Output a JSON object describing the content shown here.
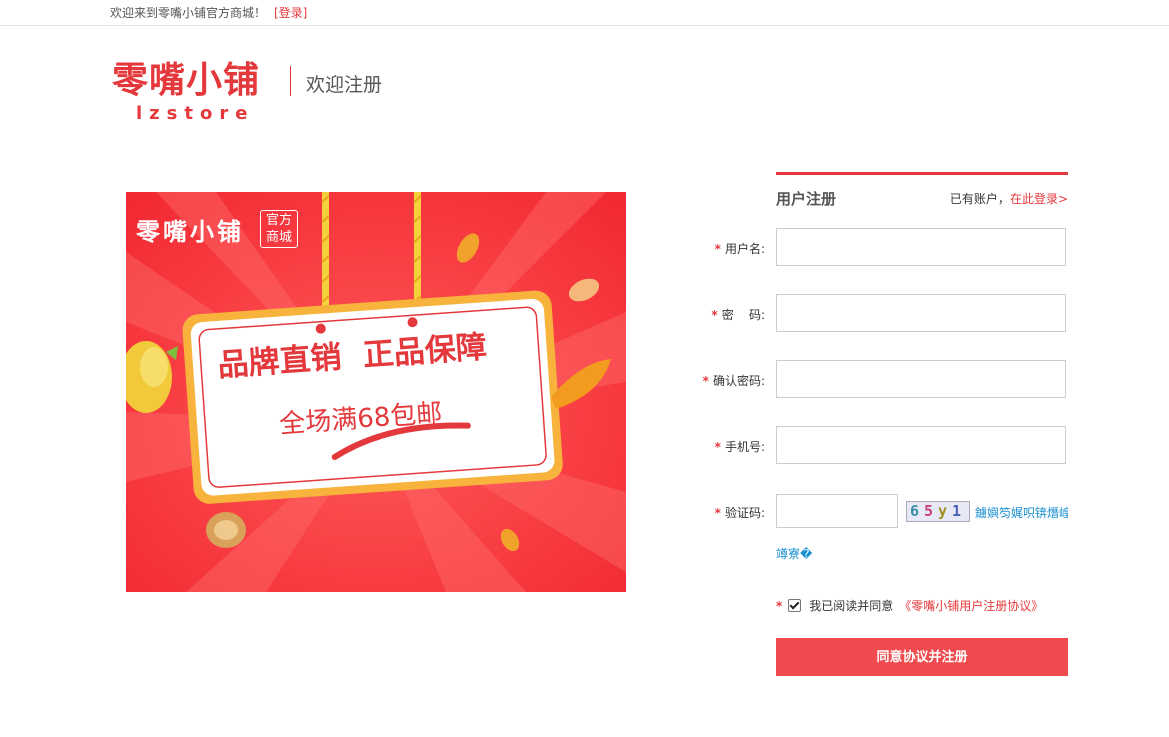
{
  "topbar": {
    "welcome": "欢迎来到零嘴小铺官方商城！",
    "login_link": "[登录]"
  },
  "header": {
    "logo_cn": "零嘴小铺",
    "logo_en": "lzstore",
    "page_title": "欢迎注册"
  },
  "banner": {
    "brand": "零嘴小铺",
    "badge_line1": "官方",
    "badge_line2": "商城",
    "headline": "品牌直销  正品保障",
    "subline": "全场满68包邮"
  },
  "form": {
    "title": "用户注册",
    "has_account": "已有账户，",
    "login_here": "在此登录>",
    "fields": {
      "username": {
        "label": "用户名:",
        "value": ""
      },
      "password": {
        "label": "密    码:",
        "value": ""
      },
      "confirm": {
        "label": "确认密码:",
        "value": ""
      },
      "phone": {
        "label": "手机号:",
        "value": ""
      },
      "captcha": {
        "label": "验证码:",
        "value": ""
      }
    },
    "captcha_chars": [
      "6",
      "5",
      "y",
      "1"
    ],
    "captcha_refresh": "鐪嬩笉娓呮锛熸崲",
    "captcha_refresh2": "竴寮�",
    "agree_text": "我已阅读并同意",
    "agree_link": "《零嘴小铺用户注册协议》",
    "submit": "同意协议并注册"
  },
  "colors": {
    "accent": "#e4393c",
    "button": "#ef4a4d",
    "link_blue": "#1a8fd0"
  }
}
